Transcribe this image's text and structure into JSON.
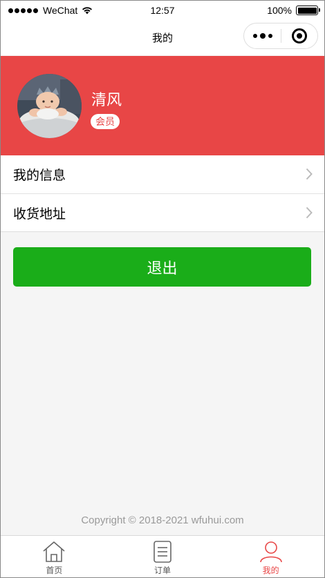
{
  "status_bar": {
    "carrier": "WeChat",
    "time": "12:57",
    "battery": "100%",
    "battery_level": 1.0
  },
  "nav": {
    "title": "我的"
  },
  "profile": {
    "name": "清风",
    "badge": "会员",
    "background_color": "#e84646"
  },
  "menu": {
    "items": [
      {
        "label": "我的信息"
      },
      {
        "label": "收货地址"
      }
    ]
  },
  "logout": {
    "label": "退出",
    "color": "#1aad19"
  },
  "footer": {
    "copyright": "Copyright © 2018-2021 wfuhui.com"
  },
  "tab_bar": {
    "active_color": "#e84646",
    "tabs": [
      {
        "label": "首页",
        "icon": "home-icon",
        "active": false
      },
      {
        "label": "订单",
        "icon": "document-icon",
        "active": false
      },
      {
        "label": "我的",
        "icon": "user-icon",
        "active": true
      }
    ]
  }
}
